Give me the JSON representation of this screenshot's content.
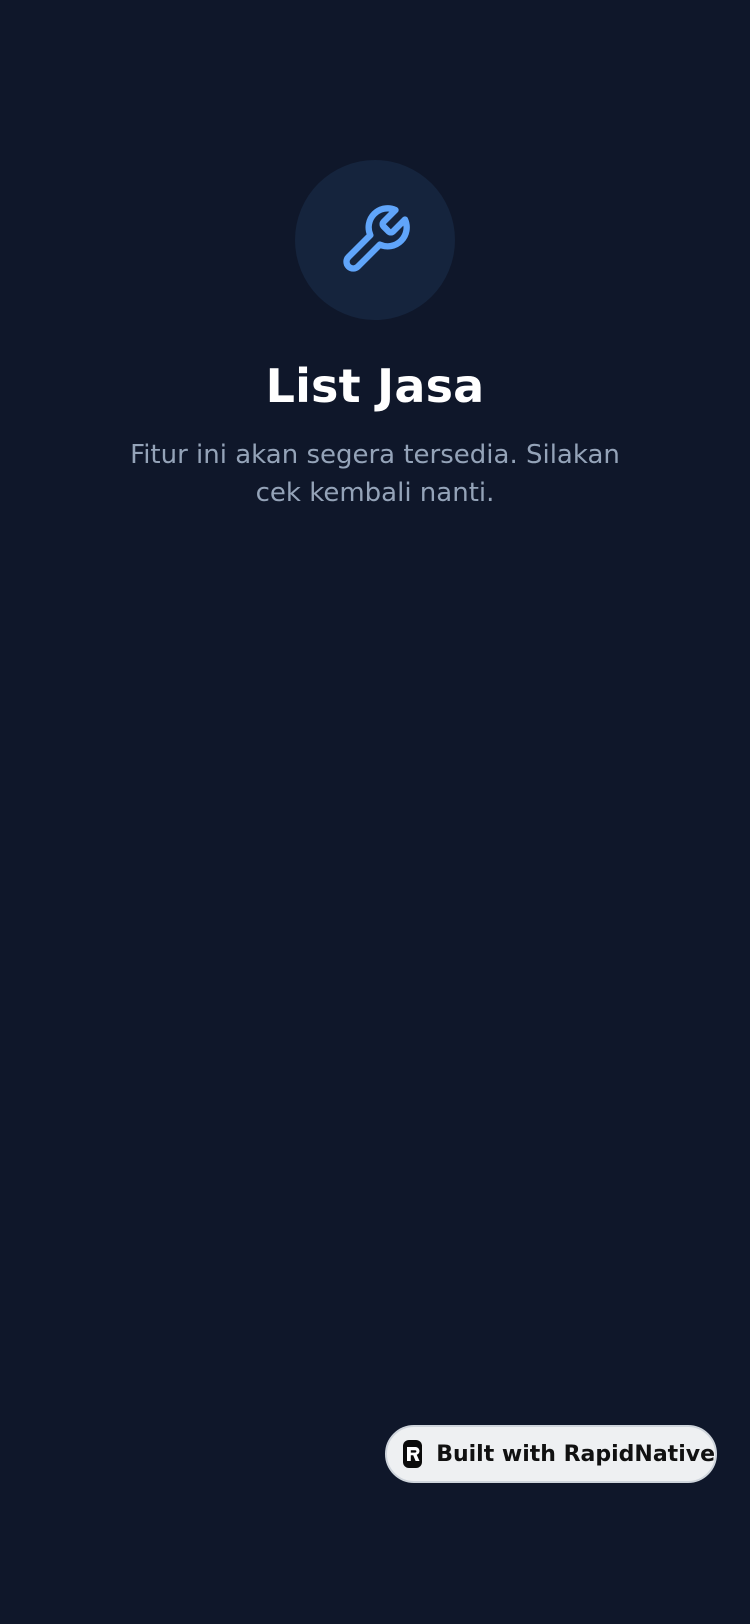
{
  "screen": {
    "icon": "wrench-icon",
    "title": "List Jasa",
    "subtitle": "Fitur ini akan segera tersedia. Silakan cek kembali nanti."
  },
  "badge": {
    "logo_icon": "rapidnative-logo-icon",
    "label": "Built with RapidNative"
  },
  "colors": {
    "background": "#0f172a",
    "icon_circle": "#15243d",
    "accent": "#60a5fa",
    "title": "#ffffff",
    "subtitle": "#94a3b8",
    "badge_background": "#eef0f2"
  }
}
